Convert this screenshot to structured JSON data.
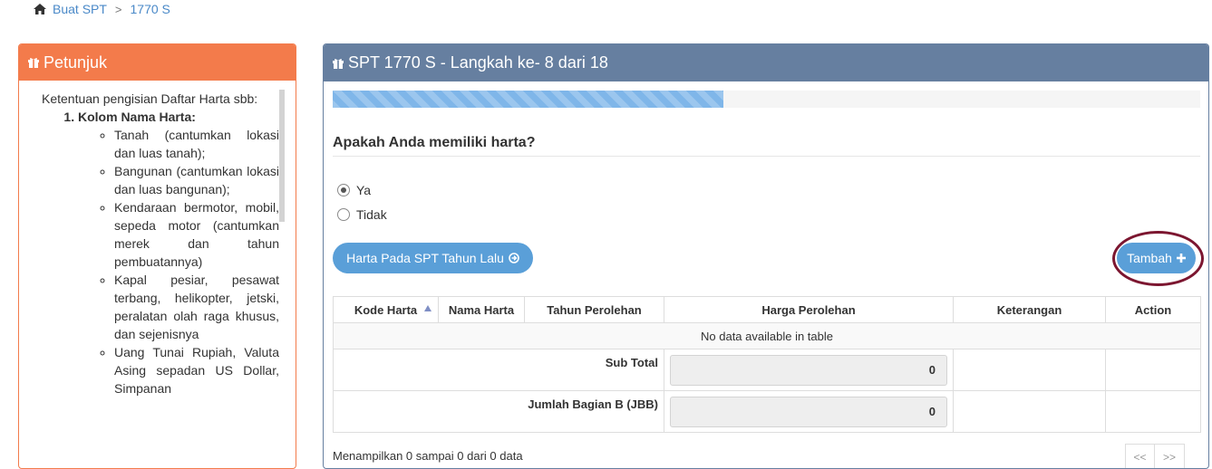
{
  "breadcrumb": {
    "items": [
      "Buat SPT",
      "1770 S"
    ],
    "separator": ">"
  },
  "instructions_panel": {
    "title": "Petunjuk",
    "intro": "Ketentuan pengisian Daftar Harta sbb:",
    "sections": [
      {
        "heading": "Kolom Nama Harta:",
        "items": [
          "Tanah (cantumkan lokasi dan luas tanah);",
          "Bangunan (cantumkan lokasi dan luas bangunan);",
          "Kendaraan bermotor, mobil, sepeda motor (cantumkan merek dan tahun pembuatannya)",
          "Kapal pesiar, pesawat terbang, helikopter, jetski, peralatan olah raga khusus, dan sejenisnya",
          "Uang Tunai Rupiah, Valuta Asing sepadan US Dollar, Simpanan"
        ]
      }
    ]
  },
  "main_panel": {
    "title": "SPT 1770 S - Langkah ke- 8 dari 18",
    "progress": 0.45,
    "question": "Apakah Anda memiliki harta?",
    "options": [
      {
        "label": "Ya",
        "checked": true
      },
      {
        "label": "Tidak",
        "checked": false
      }
    ],
    "prev_year_button": "Harta Pada SPT Tahun Lalu",
    "add_button": "Tambah"
  },
  "table": {
    "columns": [
      "Kode Harta",
      "Nama Harta",
      "Tahun Perolehan",
      "Harga Perolehan",
      "Keterangan",
      "Action"
    ],
    "empty_text": "No data available in table",
    "subtotal_label": "Sub Total",
    "subtotal_value": "0",
    "jbb_label": "Jumlah Bagian B (JBB)",
    "jbb_value": "0",
    "info": "Menampilkan 0 sampai 0 dari 0 data",
    "pager": [
      "<<",
      ">>"
    ]
  },
  "colors": {
    "link": "#4a89c8",
    "left_header": "#f37b4b",
    "right_header": "#667fa0",
    "button": "#5a9fd8",
    "highlight_ring": "#7c1630",
    "progress_fill": "#7fb6e9"
  }
}
